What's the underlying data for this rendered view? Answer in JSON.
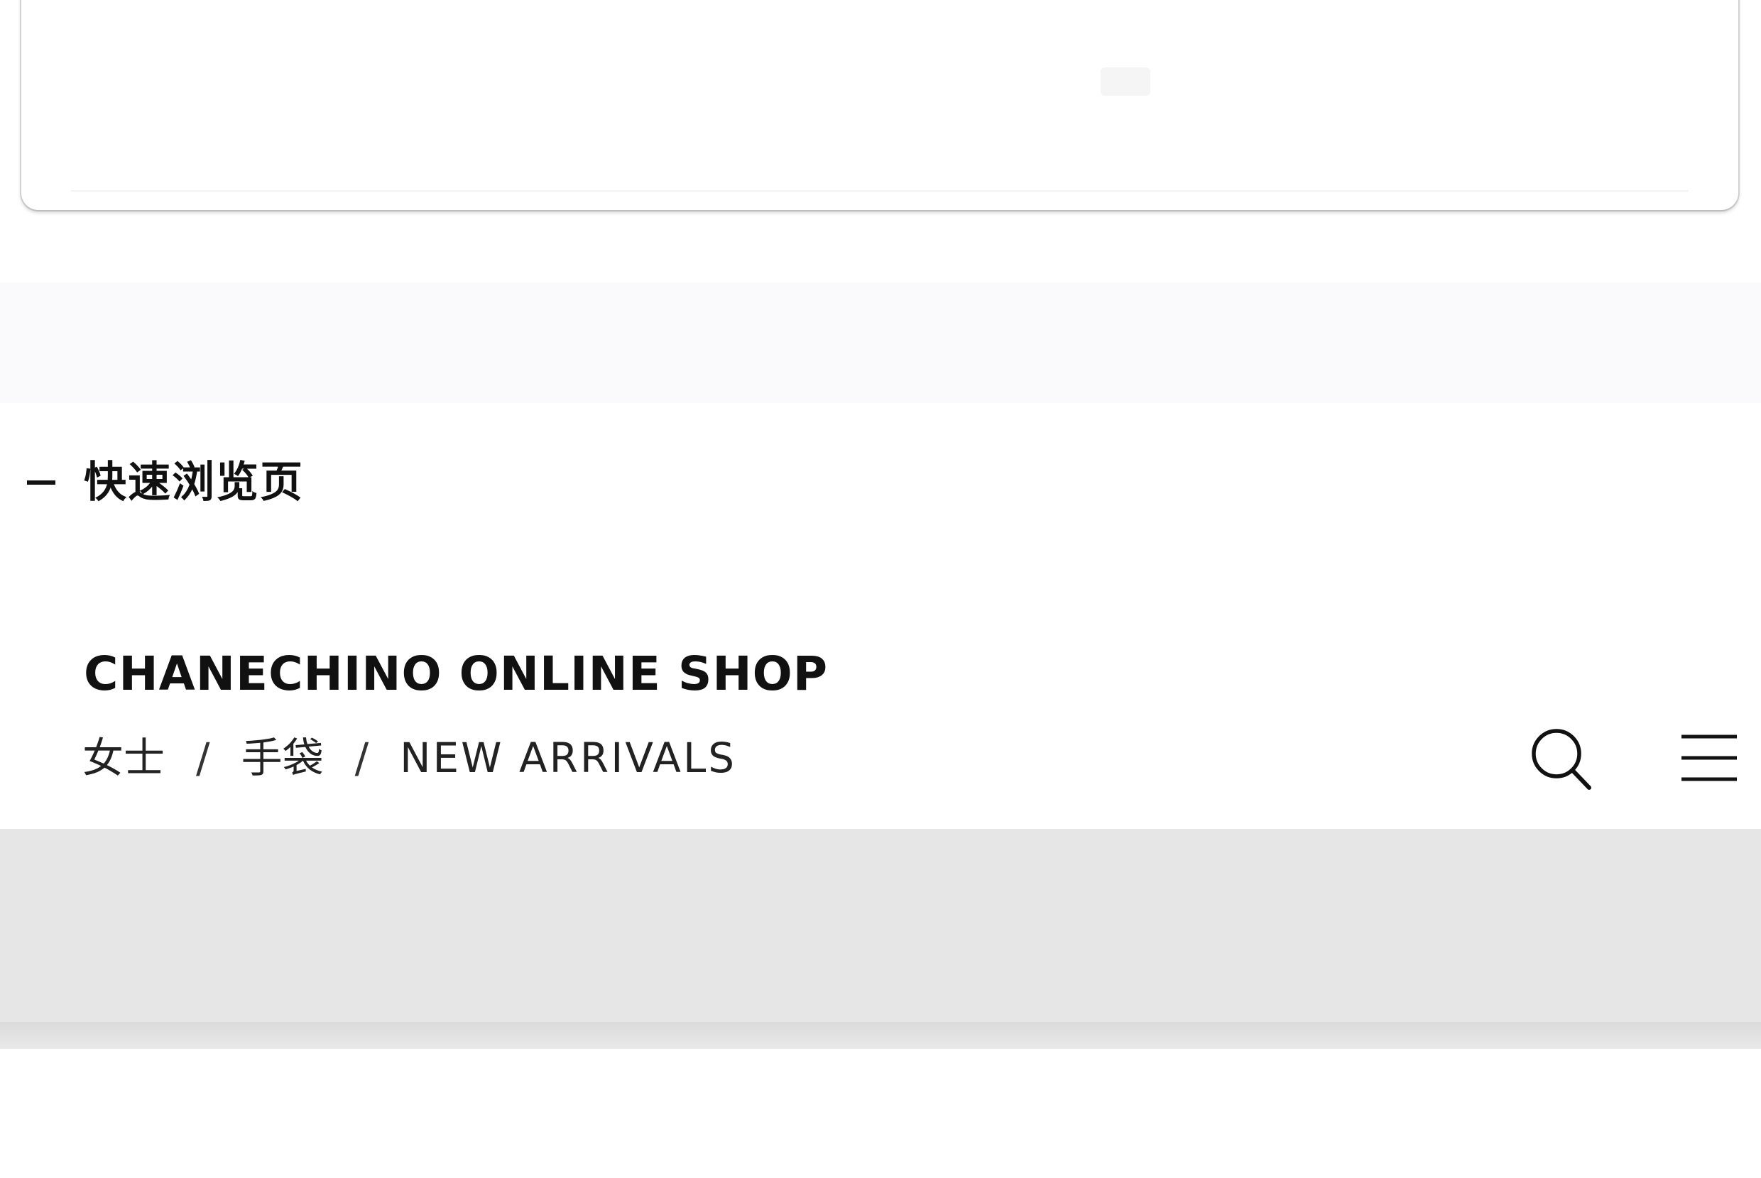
{
  "quick_view": {
    "title": "快速浏览页"
  },
  "shop": {
    "brand": "CHANECHINO  ONLINE SHOP"
  },
  "breadcrumb": {
    "items": [
      "女士",
      "手袋",
      "NEW ARRIVALS"
    ],
    "separator": "/"
  },
  "icons": {
    "search": "search-icon",
    "menu": "hamburger-menu-icon"
  },
  "colors": {
    "text": "#111111",
    "banner": "#e6e6e6",
    "band": "#fafafd"
  }
}
